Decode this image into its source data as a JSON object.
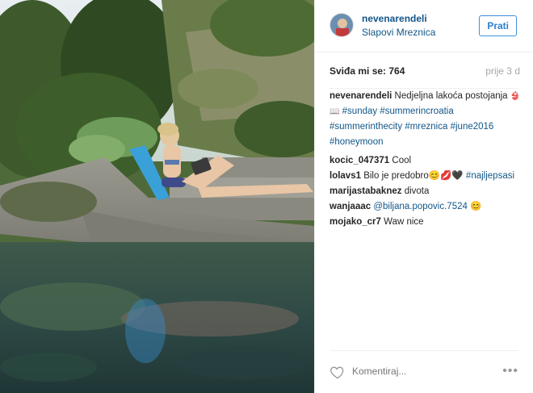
{
  "header": {
    "username": "nevenarendeli",
    "location": "Slapovi Mreznica",
    "follow_label": "Prati"
  },
  "stats": {
    "likes_label": "Sviđa mi se:",
    "likes_count": "764",
    "time_ago": "prije 3 d"
  },
  "caption": {
    "user": "nevenarendeli",
    "text": "Nedjeljna lakoća postojanja",
    "emoji": "👙📖",
    "tags": [
      "#sunday",
      "#summerincroatia",
      "#summerinthecity",
      "#mreznica",
      "#june2016",
      "#honeymoon"
    ]
  },
  "comments": [
    {
      "user": "kocic_047371",
      "text": "Cool",
      "extra": ""
    },
    {
      "user": "lolavs1",
      "text": "Bilo je predobro😊💋🖤",
      "extra": "#najljepsasi"
    },
    {
      "user": "marijastabaknez",
      "text": "divota",
      "extra": ""
    },
    {
      "user": "wanjaaac",
      "text": "@biljana.popovic.7524",
      "extra": "😊"
    },
    {
      "user": "mojako_cr7",
      "text": "Waw nice",
      "extra": ""
    }
  ],
  "footer": {
    "comment_placeholder": "Komentiraj...",
    "more_label": "•••"
  },
  "colors": {
    "link": "#125688",
    "follow_border": "#4090db",
    "muted": "#a5a7aa"
  }
}
